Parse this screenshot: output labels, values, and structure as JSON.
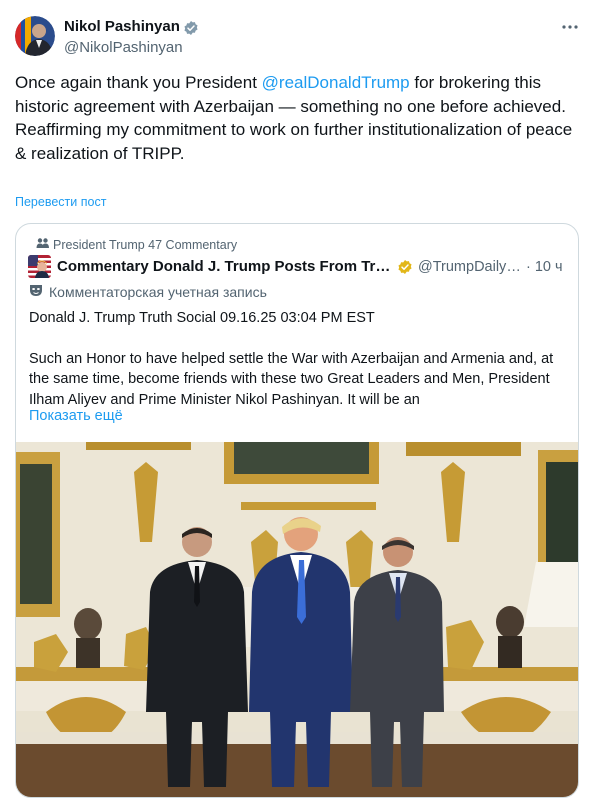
{
  "author": {
    "name": "Nikol Pashinyan",
    "handle": "@NikolPashinyan"
  },
  "tweet": {
    "text_before_mention": "Once again thank you President ",
    "mention": "@realDonaldTrump",
    "text_after_mention": " for brokering this historic agreement with Azerbaijan — something no one before achieved.",
    "line2": "Reaffirming my commitment to work on further institutionalization of peace & realization of TRIPP.",
    "translate_label": "Перевести пост"
  },
  "quote": {
    "community": "President Trump 47 Commentary",
    "name": "Commentary Donald J. Trump Posts From Truth Social",
    "handle": "@TrumpDailyPosts",
    "time": "· 10 ч",
    "account_label": "Комментаторская учетная запись",
    "text_p1": "Donald J. Trump Truth Social 09.16.25 03:04 PM EST",
    "text_p2": "Such an Honor to have helped settle the War with Azerbaijan and Armenia and, at the same time, become friends with these two Great Leaders and Men, President Ilham Aliyev and Prime Minister Nikol Pashinyan. It will be an",
    "show_more": "Показать ещё"
  },
  "colors": {
    "accent": "#1d9bf0",
    "secondary_text": "#536471",
    "verified_gold": "#e2b719"
  },
  "icons": [
    "verified-badge-icon",
    "more-icon",
    "community-icon",
    "commentary-mask-icon"
  ]
}
